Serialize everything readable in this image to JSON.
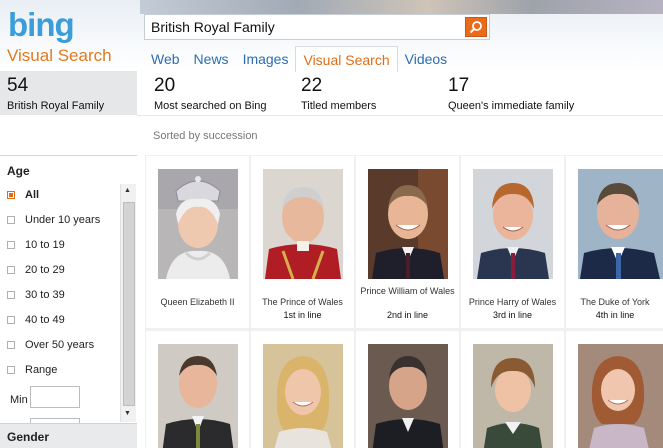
{
  "header": {
    "logo": "bing",
    "sub_logo": "Visual Search",
    "search_value": "British Royal Family"
  },
  "tabs": [
    {
      "label": "Web",
      "active": false
    },
    {
      "label": "News",
      "active": false
    },
    {
      "label": "Images",
      "active": false
    },
    {
      "label": "Visual Search",
      "active": true
    },
    {
      "label": "Videos",
      "active": false
    }
  ],
  "stats": [
    {
      "value": "54",
      "label": "British Royal Family"
    },
    {
      "value": "20",
      "label": "Most searched on Bing"
    },
    {
      "value": "22",
      "label": "Titled members"
    },
    {
      "value": "17",
      "label": "Queen's immediate family"
    }
  ],
  "sorted_by": "Sorted by succession",
  "sidebar": {
    "age_title": "Age",
    "age_options": [
      {
        "label": "All",
        "checked": true
      },
      {
        "label": "Under 10 years",
        "checked": false
      },
      {
        "label": "10 to 19",
        "checked": false
      },
      {
        "label": "20 to 29",
        "checked": false
      },
      {
        "label": "30 to 39",
        "checked": false
      },
      {
        "label": "40 to 49",
        "checked": false
      },
      {
        "label": "Over 50 years",
        "checked": false
      },
      {
        "label": "Range",
        "checked": false
      }
    ],
    "min_label": "Min",
    "gender_title": "Gender"
  },
  "cards_row1": [
    {
      "name": "Queen Elizabeth II",
      "sub": ""
    },
    {
      "name": "The Prince of Wales",
      "sub": "1st in line"
    },
    {
      "name": "Prince William of Wales",
      "sub": "2nd in line"
    },
    {
      "name": "Prince Harry of Wales",
      "sub": "3rd in line"
    },
    {
      "name": "The Duke of York",
      "sub": "4th in line"
    }
  ],
  "colors": {
    "accent": "#e06d15",
    "link": "#2d6db1",
    "logo_blue": "#3b9ed8"
  }
}
